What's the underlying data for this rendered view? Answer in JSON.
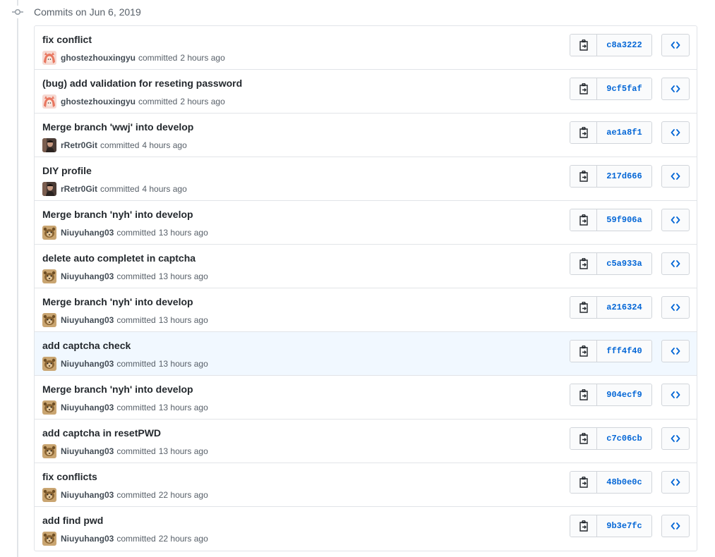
{
  "header": {
    "date_label": "Commits on Jun 6, 2019",
    "icon": "commit-node-icon"
  },
  "labels": {
    "committed": "committed"
  },
  "colors": {
    "sha_link": "#0366d6",
    "highlight_row": "#f1f8ff",
    "border": "#e1e4e8"
  },
  "commits": [
    {
      "title": "fix conflict",
      "author": "ghostezhouxingyu",
      "time": "2 hours ago",
      "sha": "c8a3222",
      "avatar": "ghostezhouxingyu"
    },
    {
      "title": "(bug) add validation for reseting password",
      "author": "ghostezhouxingyu",
      "time": "2 hours ago",
      "sha": "9cf5faf",
      "avatar": "ghostezhouxingyu"
    },
    {
      "title": "Merge branch 'wwj' into develop",
      "author": "rRetr0Git",
      "time": "4 hours ago",
      "sha": "ae1a8f1",
      "avatar": "rRetr0Git"
    },
    {
      "title": "DIY profile",
      "author": "rRetr0Git",
      "time": "4 hours ago",
      "sha": "217d666",
      "avatar": "rRetr0Git"
    },
    {
      "title": "Merge branch 'nyh' into develop",
      "author": "Niuyuhang03",
      "time": "13 hours ago",
      "sha": "59f906a",
      "avatar": "Niuyuhang03"
    },
    {
      "title": "delete auto completet in captcha",
      "author": "Niuyuhang03",
      "time": "13 hours ago",
      "sha": "c5a933a",
      "avatar": "Niuyuhang03"
    },
    {
      "title": "Merge branch 'nyh' into develop",
      "author": "Niuyuhang03",
      "time": "13 hours ago",
      "sha": "a216324",
      "avatar": "Niuyuhang03"
    },
    {
      "title": "add captcha check",
      "author": "Niuyuhang03",
      "time": "13 hours ago",
      "sha": "fff4f40",
      "avatar": "Niuyuhang03",
      "highlighted": true
    },
    {
      "title": "Merge branch 'nyh' into develop",
      "author": "Niuyuhang03",
      "time": "13 hours ago",
      "sha": "904ecf9",
      "avatar": "Niuyuhang03"
    },
    {
      "title": "add captcha in resetPWD",
      "author": "Niuyuhang03",
      "time": "13 hours ago",
      "sha": "c7c06cb",
      "avatar": "Niuyuhang03"
    },
    {
      "title": "fix conflicts",
      "author": "Niuyuhang03",
      "time": "22 hours ago",
      "sha": "48b0e0c",
      "avatar": "Niuyuhang03"
    },
    {
      "title": "add find pwd",
      "author": "Niuyuhang03",
      "time": "22 hours ago",
      "sha": "9b3e7fc",
      "avatar": "Niuyuhang03"
    }
  ]
}
